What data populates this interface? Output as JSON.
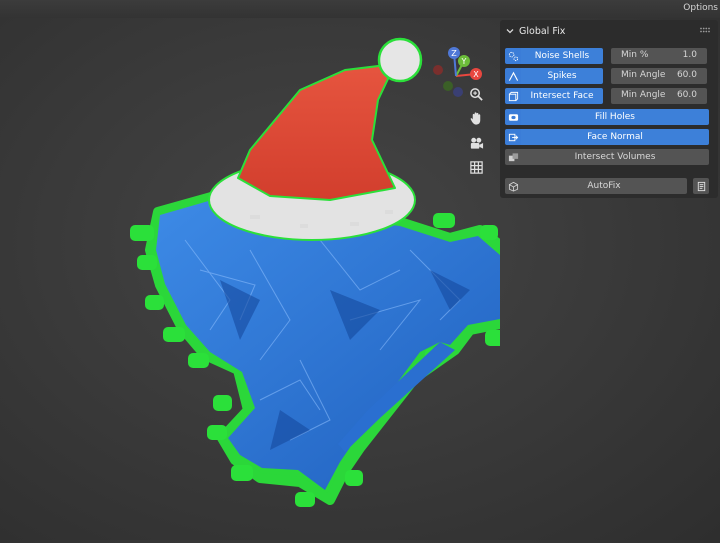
{
  "header": {
    "options_label": "Options"
  },
  "gizmo": {
    "x_label": "X",
    "y_label": "Y",
    "z_label": "Z"
  },
  "viewport_tools": [
    "zoom-icon",
    "hand-icon",
    "camera-icon",
    "grid-icon"
  ],
  "panel": {
    "title": "Global Fix",
    "rows": [
      {
        "button": "Noise Shells",
        "field_label": "Min %",
        "field_value": "1.0",
        "icon": "noise-icon"
      },
      {
        "button": "Spikes",
        "field_label": "Min Angle",
        "field_value": "60.0",
        "icon": "spike-icon"
      },
      {
        "button": "Intersect Face",
        "field_label": "Min Angle",
        "field_value": "60.0",
        "icon": "face-icon"
      },
      {
        "button": "Fill Holes",
        "icon": "fill-icon"
      },
      {
        "button": "Face Normal",
        "icon": "normal-icon"
      },
      {
        "button": "Intersect Volumes",
        "icon": "volumes-icon"
      }
    ],
    "autofix": {
      "label": "AutoFix",
      "icon": "cube-icon"
    }
  },
  "colors": {
    "accent_blue": "#3d80d9",
    "mesh_blue": "#2a6fd0",
    "outline_green": "#2be03a",
    "hat_red": "#e04a35",
    "hat_white": "#e3e3e3",
    "axis_x": "#e8473f",
    "axis_y": "#6cbd3a",
    "axis_z": "#4f78d6"
  }
}
